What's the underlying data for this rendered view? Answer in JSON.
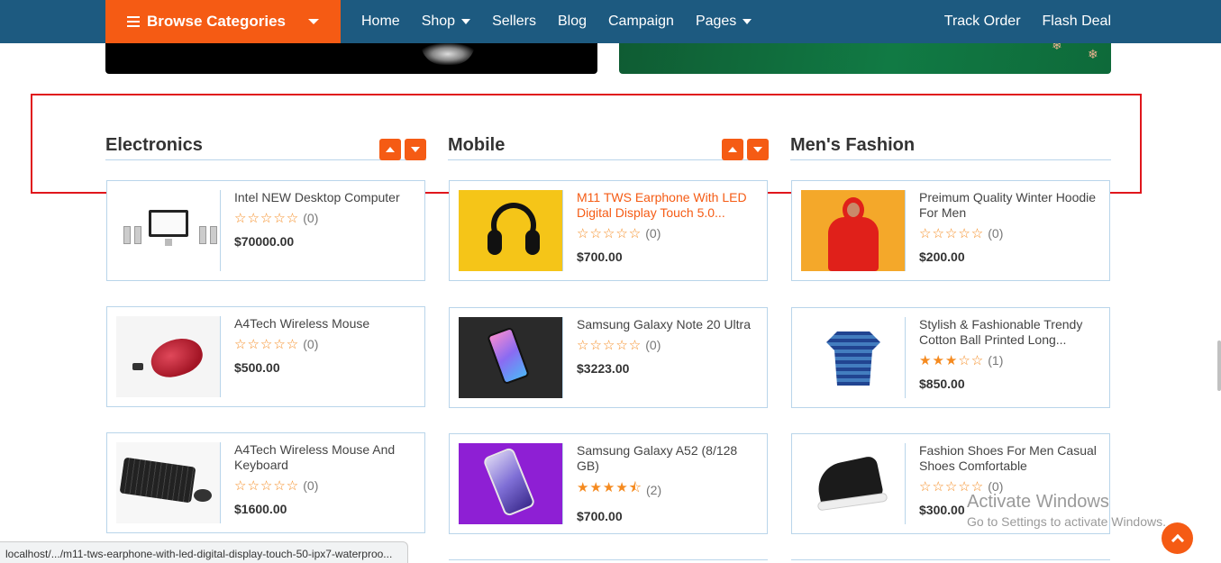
{
  "nav": {
    "browse_label": "Browse Categories",
    "links": [
      "Home",
      "Shop",
      "Sellers",
      "Blog",
      "Campaign",
      "Pages"
    ],
    "right_links": [
      "Track Order",
      "Flash Deal"
    ]
  },
  "columns": [
    {
      "title": "Electronics",
      "products": [
        {
          "name": "Intel NEW Desktop Computer",
          "rating_count": "(0)",
          "price": "$70000.00",
          "stars": "☆☆☆☆☆",
          "image": "desktop-computer-image"
        },
        {
          "name": "A4Tech Wireless Mouse",
          "rating_count": "(0)",
          "price": "$500.00",
          "stars": "☆☆☆☆☆",
          "image": "wireless-mouse-image"
        },
        {
          "name": "A4Tech Wireless Mouse And Keyboard",
          "rating_count": "(0)",
          "price": "$1600.00",
          "stars": "☆☆☆☆☆",
          "image": "keyboard-image"
        }
      ]
    },
    {
      "title": "Mobile",
      "products": [
        {
          "name": "M11 TWS Earphone With LED Digital Display Touch 5.0...",
          "rating_count": "(0)",
          "price": "$700.00",
          "stars": "☆☆☆☆☆",
          "image": "headphone-image"
        },
        {
          "name": "Samsung Galaxy Note 20 Ultra",
          "rating_count": "(0)",
          "price": "$3223.00",
          "stars": "☆☆☆☆☆",
          "image": "phone-image"
        },
        {
          "name": "Samsung Galaxy A52 (8/128 GB)",
          "rating_count": "(2)",
          "price": "$700.00",
          "stars": "★★★★⯪",
          "image": "phone-image"
        }
      ]
    },
    {
      "title": "Men's Fashion",
      "products": [
        {
          "name": "Preimum Quality Winter Hoodie For Men",
          "rating_count": "(0)",
          "price": "$200.00",
          "stars": "☆☆☆☆☆",
          "image": "hoodie-image"
        },
        {
          "name": "Stylish & Fashionable Trendy Cotton Ball Printed Long...",
          "rating_count": "(1)",
          "price": "$850.00",
          "stars": "★★★☆☆",
          "image": "shirt-image"
        },
        {
          "name": "Fashion Shoes For Men Casual Shoes Comfortable",
          "rating_count": "(0)",
          "price": "$300.00",
          "stars": "☆☆☆☆☆",
          "image": "shoe-image"
        }
      ]
    }
  ],
  "statusbar": "localhost/.../m11-tws-earphone-with-led-digital-display-touch-50-ipx7-waterproo...",
  "watermark": {
    "line1": "Activate Windows",
    "line2": "Go to Settings to activate Windows."
  },
  "colors": {
    "nav_bg": "#1d5a80",
    "accent": "#f55b14",
    "highlight": "#e0161c",
    "star": "#f58a1f"
  }
}
